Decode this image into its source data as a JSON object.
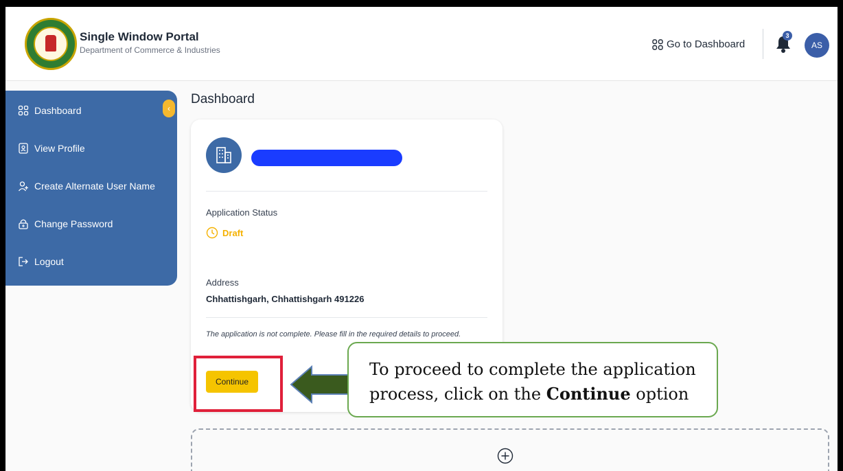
{
  "header": {
    "title": "Single Window Portal",
    "subtitle": "Department of Commerce & Industries",
    "goto_dashboard": "Go to Dashboard",
    "notification_count": "3",
    "avatar_initials": "AS"
  },
  "sidebar": {
    "items": [
      {
        "label": "Dashboard",
        "icon": "grid-icon"
      },
      {
        "label": "View Profile",
        "icon": "profile-icon"
      },
      {
        "label": "Create Alternate User Name",
        "icon": "add-user-icon"
      },
      {
        "label": "Change Password",
        "icon": "lock-icon"
      },
      {
        "label": "Logout",
        "icon": "logout-icon"
      }
    ]
  },
  "main": {
    "page_title": "Dashboard",
    "card": {
      "status_label": "Application Status",
      "status_value": "Draft",
      "address_label": "Address",
      "address_value": "Chhattishgarh, Chhattishgarh 491226",
      "note": "The application is not complete. Please fill in the required details to proceed.",
      "continue_label": "Continue"
    }
  },
  "annotation": {
    "text_before": "To proceed to complete the application process, click on the",
    "text_bold": "Continue",
    "text_after": "option"
  },
  "colors": {
    "primary": "#3d6aa6",
    "accent": "#f5c400",
    "draft": "#f5b100",
    "highlight": "#e0203a",
    "arrow": "#3a5a1e"
  }
}
